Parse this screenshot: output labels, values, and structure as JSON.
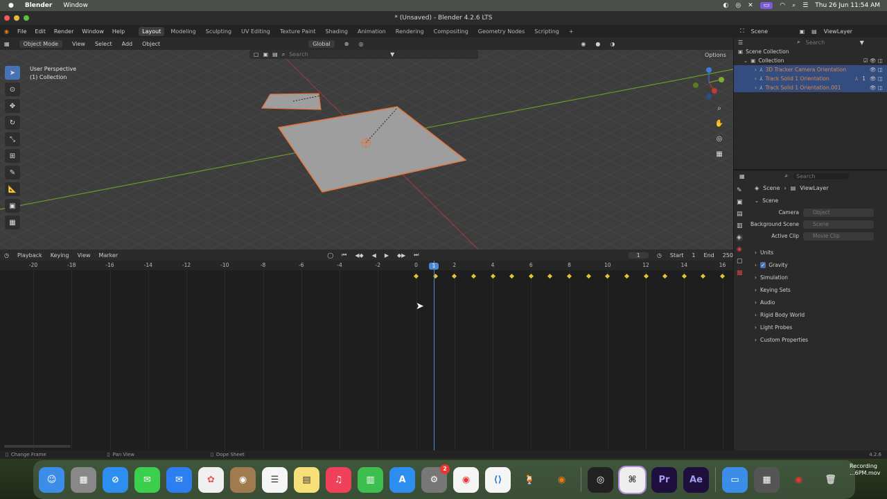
{
  "mac_menu": {
    "app": "Blender",
    "window": "Window",
    "clock": "Thu 26 Jun  11:54 AM"
  },
  "window_title": "* (Unsaved) - Blender 4.2.6 LTS",
  "top_menu": [
    "File",
    "Edit",
    "Render",
    "Window",
    "Help"
  ],
  "workspaces": [
    "Layout",
    "Modeling",
    "Sculpting",
    "UV Editing",
    "Texture Paint",
    "Shading",
    "Animation",
    "Rendering",
    "Compositing",
    "Geometry Nodes",
    "Scripting"
  ],
  "active_workspace": "Layout",
  "scene_field": "Scene",
  "viewlayer_field": "ViewLayer",
  "viewport_header": {
    "mode": "Object Mode",
    "view": "View",
    "select": "Select",
    "add": "Add",
    "object": "Object",
    "orientation": "Global",
    "search_placeholder": "Search",
    "options": "Options"
  },
  "viewport_info": {
    "line1": "User Perspective",
    "line2": "(1) Collection"
  },
  "timeline_header": {
    "playback": "Playback",
    "keying": "Keying",
    "view": "View",
    "marker": "Marker",
    "current_frame": "1",
    "start_label": "Start",
    "start": "1",
    "end_label": "End",
    "end": "250"
  },
  "timeline_ticks": [
    "-20",
    "-18",
    "-16",
    "-14",
    "-12",
    "-10",
    "-8",
    "-6",
    "-4",
    "-2",
    "0",
    "2",
    "4",
    "6",
    "8",
    "10",
    "12",
    "14",
    "16"
  ],
  "current_frame_marker": "1",
  "outliner": {
    "search_placeholder": "Search",
    "root": "Scene Collection",
    "collection": "Collection",
    "items": [
      "3D Tracker Camera Orientation",
      "Track Solid 1 Orientation",
      "Track Solid 1 Orientation.001"
    ],
    "item_badge": "1"
  },
  "properties": {
    "search_placeholder": "Search",
    "breadcrumb_scene": "Scene",
    "breadcrumb_viewlayer": "ViewLayer",
    "scene_section": "Scene",
    "camera_label": "Camera",
    "camera_placeholder": "Object",
    "background_label": "Background Scene",
    "background_placeholder": "Scene",
    "active_clip_label": "Active Clip",
    "active_clip_placeholder": "Movie Clip",
    "sections": [
      "Units",
      "Gravity",
      "Simulation",
      "Keying Sets",
      "Audio",
      "Rigid Body World",
      "Light Probes",
      "Custom Properties"
    ]
  },
  "status_bar": {
    "change_frame": "Change Frame",
    "pan_view": "Pan View",
    "dope_sheet": "Dope Sheet",
    "version": "4.2.6"
  },
  "dock": {
    "apps": [
      "Finder",
      "Launchpad",
      "Safari",
      "Messages",
      "Mail",
      "Photos",
      "Contacts",
      "Reminders",
      "Notes",
      "Music",
      "Numbers",
      "App Store",
      "System Settings",
      "Chrome",
      "VS Code",
      "Cocktail",
      "Blender",
      "OBS",
      "Keyboard",
      "Premiere Pro",
      "After Effects",
      "Folder",
      "Screenshot",
      "Chrome2",
      "Trash"
    ],
    "settings_badge": "2",
    "recording_label": "Recording",
    "recording_file": "...6PM.mov",
    "pr_label": "Pr",
    "ae_label": "Ae"
  }
}
